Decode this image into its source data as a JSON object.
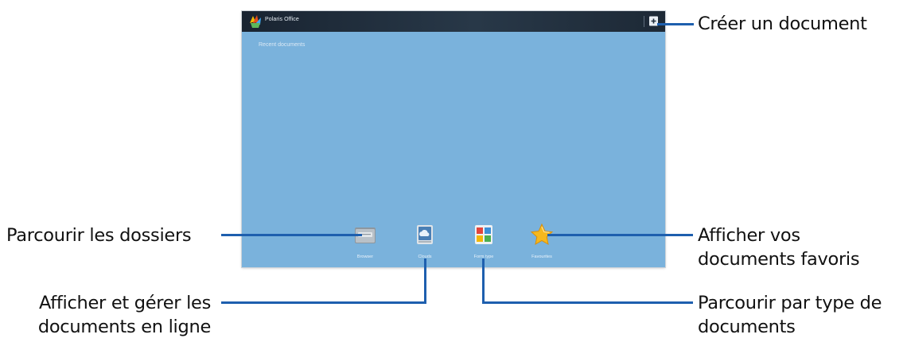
{
  "app": {
    "title": "Polaris Office",
    "recent_label": "Recent documents"
  },
  "dock": [
    {
      "label": "Browser",
      "icon": "folder-icon"
    },
    {
      "label": "Clouds",
      "icon": "cloud-icon"
    },
    {
      "label": "Form type",
      "icon": "form-type-icon"
    },
    {
      "label": "Favourites",
      "icon": "star-icon"
    }
  ],
  "callouts": {
    "create_document": "Créer un document",
    "browse_folders": "Parcourir les dossiers",
    "show_favourites_line1": "Afficher vos",
    "show_favourites_line2": "documents favoris",
    "manage_online_line1": "Afficher et gérer les",
    "manage_online_line2": "documents en ligne",
    "browse_by_type_line1": "Parcourir par type de",
    "browse_by_type_line2": "documents"
  },
  "colors": {
    "screen_background": "#7ab2dc",
    "titlebar": "#1f2c3a",
    "callout_line": "#1e5fae"
  }
}
